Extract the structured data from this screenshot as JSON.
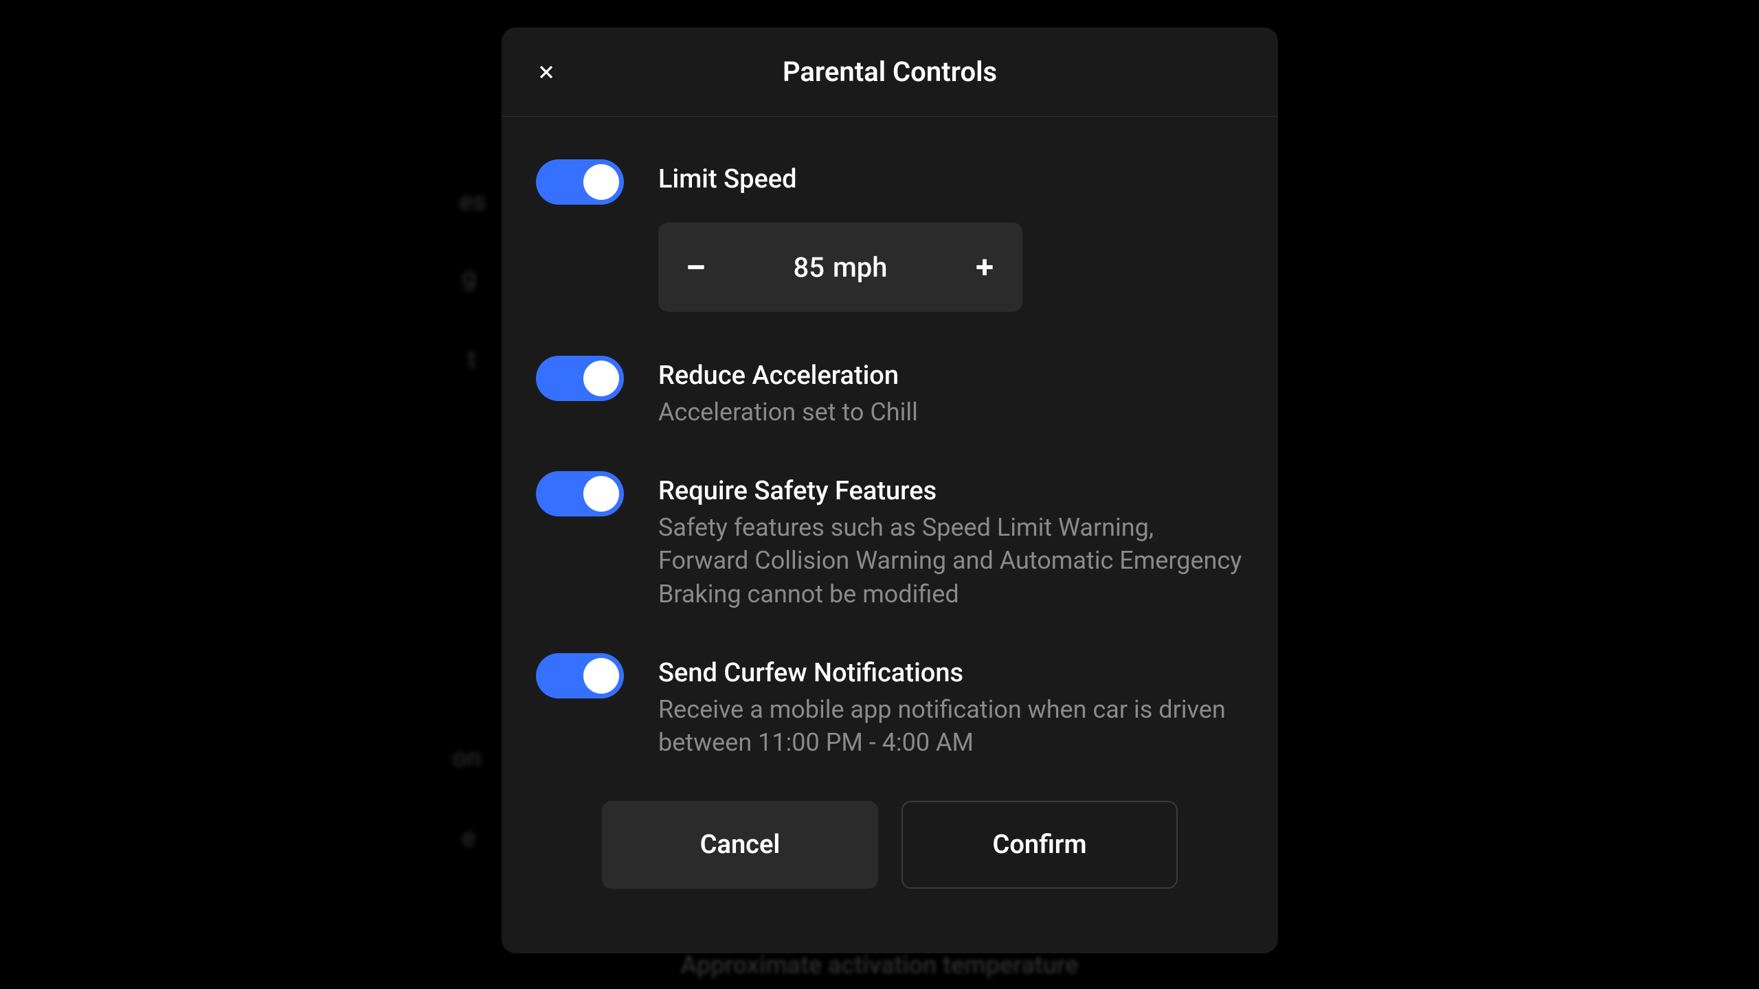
{
  "modal": {
    "title": "Parental Controls"
  },
  "settings": {
    "limitSpeed": {
      "label": "Limit Speed",
      "value": "85",
      "unit": "mph"
    },
    "reduceAccel": {
      "label": "Reduce Acceleration",
      "desc": "Acceleration set to Chill"
    },
    "safetyFeatures": {
      "label": "Require Safety Features",
      "desc": "Safety features such as Speed Limit Warning, Forward Collision Warning and Automatic Emergency Braking cannot be modified"
    },
    "curfew": {
      "label": "Send Curfew Notifications",
      "desc": "Receive a mobile app notification when car is driven between 11:00 PM - 4:00 AM"
    }
  },
  "buttons": {
    "cancel": "Cancel",
    "confirm": "Confirm"
  },
  "background": {
    "word1": "es",
    "word2": "g",
    "word3": "t",
    "word4": "on",
    "word5": "e",
    "hint": "Approximate activation temperature"
  }
}
